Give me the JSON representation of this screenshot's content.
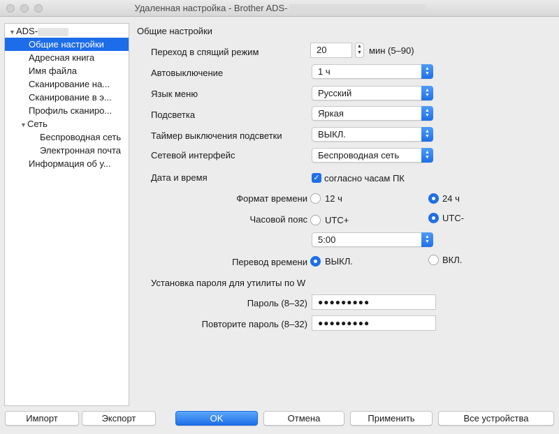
{
  "window": {
    "title_prefix": "Удаленная настройка - Brother ADS-"
  },
  "tree": {
    "root_label": "ADS-",
    "items": [
      "Общие настройки",
      "Адресная книга",
      "Имя файла",
      "Сканирование на...",
      "Сканирование в э...",
      "Профиль сканиро..."
    ],
    "network": {
      "label": "Сеть",
      "children": [
        "Беспроводная сеть",
        "Электронная почта"
      ]
    },
    "info": "Информация об у..."
  },
  "general": {
    "title": "Общие настройки",
    "sleep": {
      "label": "Переход в спящий режим",
      "value": "20",
      "unit": "мин (5–90)"
    },
    "auto_off": {
      "label": "Автовыключение",
      "value": "1 ч"
    },
    "language": {
      "label": "Язык меню",
      "value": "Русский"
    },
    "backlight": {
      "label": "Подсветка",
      "value": "Яркая"
    },
    "backlight_timer": {
      "label": "Таймер выключения подсветки",
      "value": "ВЫКЛ."
    },
    "interface": {
      "label": "Сетевой интерфейс",
      "value": "Беспроводная сеть"
    }
  },
  "datetime": {
    "label": "Дата и время",
    "sync_pc": "согласно часам ПК",
    "time_format": {
      "label": "Формат времени",
      "opt12": "12 ч",
      "opt24": "24 ч"
    },
    "timezone": {
      "label": "Часовой пояс",
      "plus": "UTC+",
      "minus": "UTC-",
      "value": "5:00"
    },
    "dst": {
      "label": "Перевод времени",
      "off": "ВЫКЛ.",
      "on": "ВКЛ."
    }
  },
  "password": {
    "section_label": "Установка пароля для утилиты по W",
    "label": "Пароль (8–32)",
    "confirm_label": "Повторите пароль (8–32)",
    "value": "●●●●●●●●●",
    "confirm_value": "●●●●●●●●●"
  },
  "buttons": {
    "import": "Импорт",
    "export": "Экспорт",
    "ok": "OK",
    "cancel": "Отмена",
    "apply": "Применить",
    "all_devices": "Все устройства"
  },
  "icons": {
    "expand": "disclosure-triangle-icon",
    "select": "select-arrows-icon",
    "check": "checkmark-icon"
  },
  "colors": {
    "accent": "#1f6fe7",
    "selection": "#1d6ce9"
  }
}
